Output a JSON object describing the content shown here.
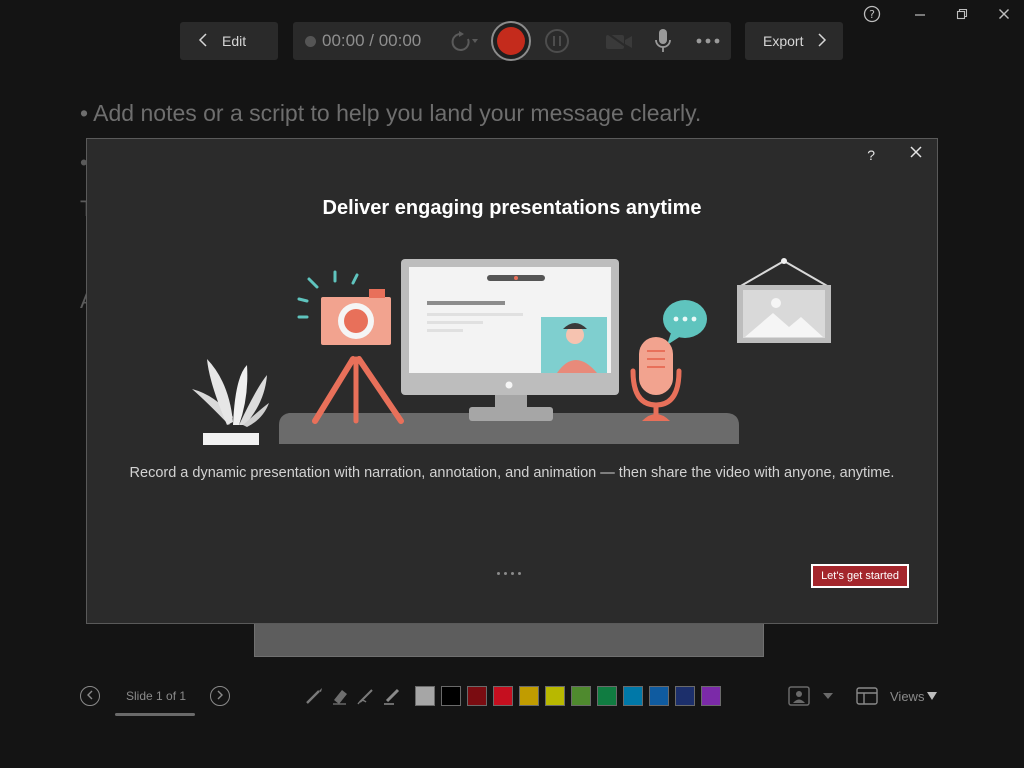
{
  "window": {
    "controls": [
      {
        "name": "help-icon"
      },
      {
        "name": "minimize-icon"
      },
      {
        "name": "restore-icon"
      },
      {
        "name": "close-icon"
      }
    ]
  },
  "toolbar": {
    "edit_label": "Edit",
    "export_label": "Export",
    "timer": "00:00 / 00:00",
    "icons": [
      "back-chevron-icon",
      "replay-icon",
      "record-icon",
      "pause-icon",
      "camera-icon",
      "microphone-icon",
      "more-icon",
      "forward-chevron-icon"
    ]
  },
  "notes": {
    "line1": "• Add notes or a script to help you land your message clearly."
  },
  "modal": {
    "help": "?",
    "title": "Deliver engaging presentations anytime",
    "description": "Record a dynamic presentation with narration, annotation, and animation — then share the video with anyone, anytime.",
    "cta_label": "Let's get started",
    "pager_dots": 4
  },
  "bottom": {
    "slide_counter": "Slide 1 of 1",
    "views_label": "Views",
    "pen_tools": [
      "pen-icon",
      "eraser-icon",
      "pencil-icon",
      "highlighter-icon"
    ],
    "swatches": [
      "#a6a6a6",
      "#000000",
      "#7a0c11",
      "#c50f1f",
      "#c19c00",
      "#b8b800",
      "#4f8a2e",
      "#107c41",
      "#0078a8",
      "#0f5ba0",
      "#1c2f6b",
      "#7b2aa8"
    ]
  },
  "colors": {
    "accent_record": "#c42b1c",
    "cta_background": "#a4262c",
    "illustration_coral": "#e8705a",
    "illustration_teal": "#5fc4be"
  }
}
